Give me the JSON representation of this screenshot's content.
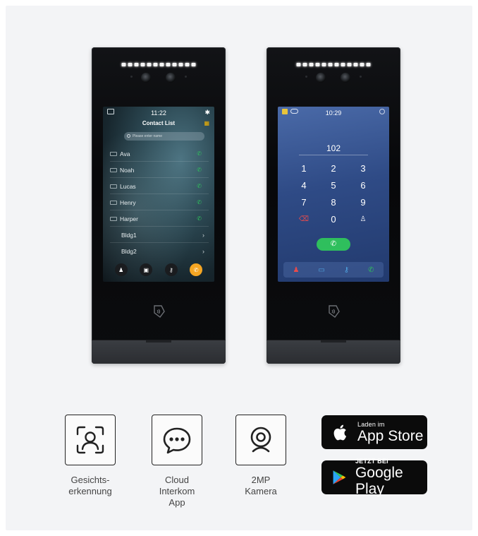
{
  "device_left": {
    "screen": {
      "time": "11:22",
      "title": "Contact List",
      "search_placeholder": "Please enter name",
      "contacts": [
        "Ava",
        "Noah",
        "Lucas",
        "Henry",
        "Harper"
      ],
      "buildings": [
        "Bldg1",
        "Bldg2"
      ],
      "dock": [
        "face-icon",
        "card-icon",
        "key-icon",
        "phone-icon"
      ]
    }
  },
  "device_right": {
    "screen": {
      "time": "10:29",
      "display": "102",
      "keys": [
        "1",
        "2",
        "3",
        "4",
        "5",
        "6",
        "7",
        "8",
        "9",
        "⌫",
        "0",
        "contact"
      ],
      "dock": [
        "face-icon",
        "card-icon",
        "key-icon",
        "phone-icon"
      ]
    }
  },
  "features": [
    {
      "icon": "face-recognition-icon",
      "line1": "Gesichts-",
      "line2": "erkennung"
    },
    {
      "icon": "chat-bubble-icon",
      "line1": "Cloud",
      "line2": "Interkom App"
    },
    {
      "icon": "webcam-icon",
      "line1": "2MP",
      "line2": "Kamera"
    }
  ],
  "badges": {
    "appstore": {
      "small": "Laden im",
      "big": "App Store"
    },
    "googleplay": {
      "small": "JETZT BEI",
      "big": "Google Play"
    }
  },
  "colors": {
    "accent_orange": "#f5a623",
    "call_green": "#2fbf5d",
    "background": "#f3f4f6"
  }
}
